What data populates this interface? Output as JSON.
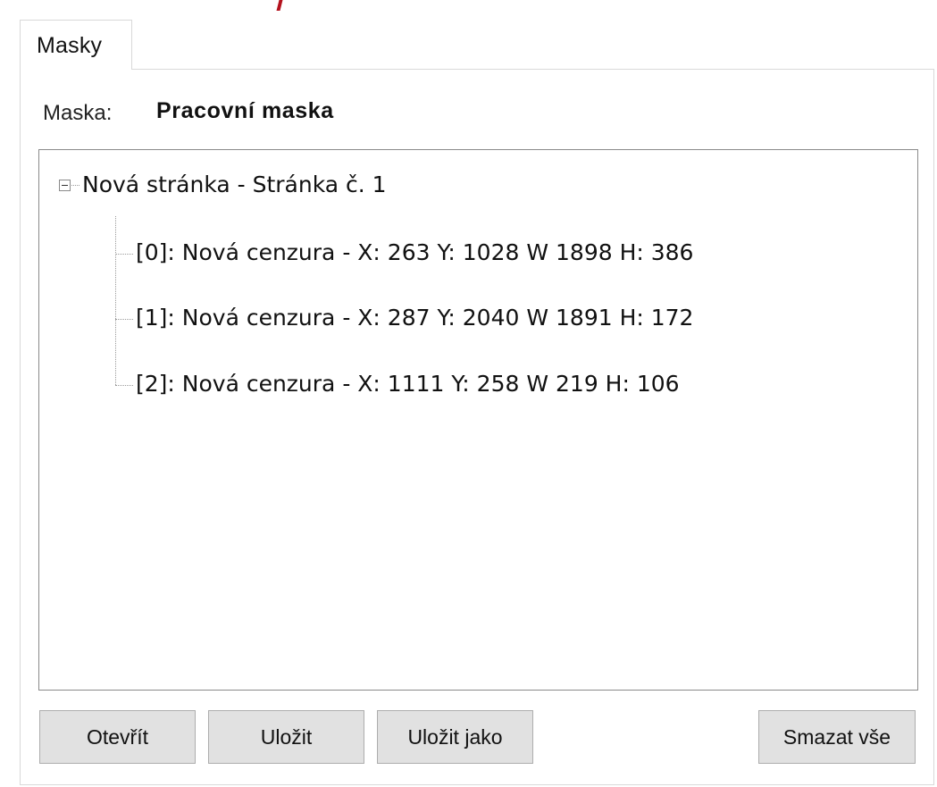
{
  "tab": {
    "label": "Masky"
  },
  "mask": {
    "label": "Maska:",
    "name": "Pracovní maska"
  },
  "tree": {
    "root": {
      "label": "Nová stránka - Stránka č. 1",
      "expanded": true
    },
    "children": [
      {
        "label": "[0]: Nová cenzura - X: 263 Y: 1028 W 1898 H: 386"
      },
      {
        "label": "[1]: Nová cenzura - X: 287 Y: 2040 W 1891 H: 172"
      },
      {
        "label": "[2]: Nová cenzura - X: 1111 Y: 258 W 219 H: 106"
      }
    ]
  },
  "buttons": {
    "open": "Otevřít",
    "save": "Uložit",
    "save_as": "Uložit jako",
    "clear_all": "Smazat vše"
  },
  "colors": {
    "accent_cut": "#b4121e",
    "panel_border": "#d9d9d9",
    "button_face": "#e1e1e1"
  }
}
